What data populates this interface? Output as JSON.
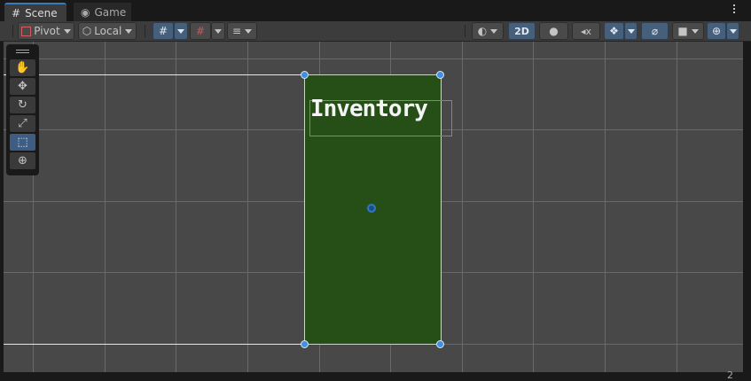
{
  "tabs": [
    {
      "label": "Scene",
      "icon": "grid-icon",
      "glyph": "#",
      "active": true
    },
    {
      "label": "Game",
      "icon": "gamepad-icon",
      "glyph": "◉",
      "active": false
    }
  ],
  "toolbar": {
    "pivot_label": "Pivot",
    "local_label": "Local",
    "mode_2d_label": "2D"
  },
  "scene": {
    "ui_text": "Inventory",
    "panel_color": "#264f18"
  },
  "tools": [
    {
      "name": "hand-tool",
      "glyph": "✋",
      "active": false
    },
    {
      "name": "move-tool",
      "glyph": "✥",
      "active": false
    },
    {
      "name": "rotate-tool",
      "glyph": "↻",
      "active": false
    },
    {
      "name": "scale-tool",
      "glyph": "⤢",
      "active": false
    },
    {
      "name": "rect-tool",
      "glyph": "⬚",
      "active": true
    },
    {
      "name": "transform-tool",
      "glyph": "⊕",
      "active": false
    }
  ],
  "status": {
    "counter": "2"
  },
  "colors": {
    "accent": "#3a79bb",
    "background": "#484848",
    "grid": "#696969"
  }
}
